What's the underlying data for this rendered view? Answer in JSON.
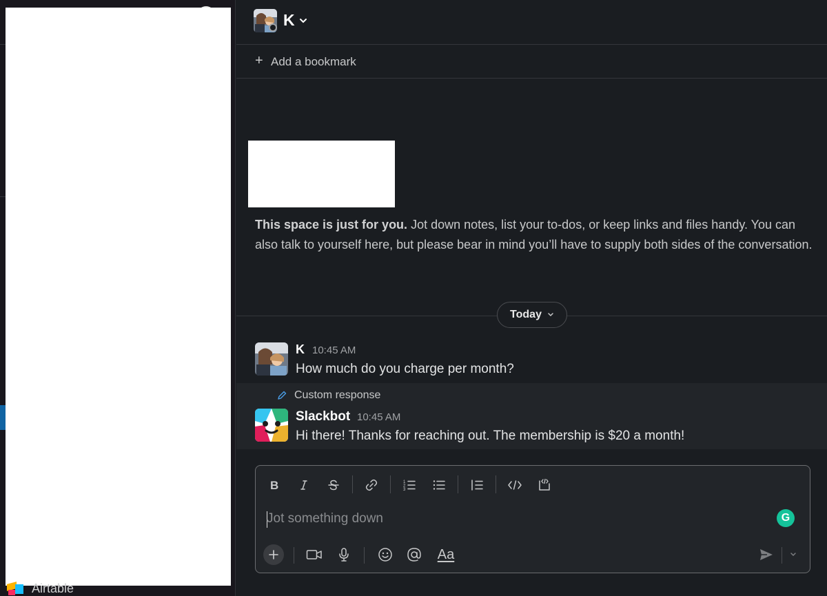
{
  "sidebar": {
    "bottom_item_label": "Airtable"
  },
  "header": {
    "user_name": "K"
  },
  "bookmark_bar": {
    "add_label": "Add a bookmark"
  },
  "intro": {
    "lead_bold": "This space is just for you.",
    "body": " Jot down notes, list your to-dos, or keep links and files handy. You can also talk to yourself here, but please bear in mind you’ll have to supply both sides of the conversation."
  },
  "date_divider": {
    "label": "Today"
  },
  "messages": [
    {
      "author": "K",
      "time": "10:45 AM",
      "text": "How much do you charge per month?"
    },
    {
      "context_label": "Custom response",
      "author": "Slackbot",
      "time": "10:45 AM",
      "text": "Hi there! Thanks for reaching out. The membership is $20 a month!"
    }
  ],
  "composer": {
    "placeholder": "Jot something down",
    "format_label": "Aa",
    "grammarly_letter": "G",
    "toolbar_icons": [
      "bold-icon",
      "italic-icon",
      "strikethrough-icon",
      "link-icon",
      "ordered-list-icon",
      "bulleted-list-icon",
      "blockquote-icon",
      "code-icon",
      "code-block-icon"
    ],
    "bottom_icons": [
      "plus-icon",
      "video-icon",
      "microphone-icon",
      "emoji-icon",
      "mention-icon",
      "formatting-icon",
      "send-icon",
      "send-options-chevron-icon"
    ]
  },
  "colors": {
    "background": "#1a1d21",
    "sidebar": "#19171d",
    "active_accent": "#1164a3",
    "grammarly": "#15c39a"
  }
}
